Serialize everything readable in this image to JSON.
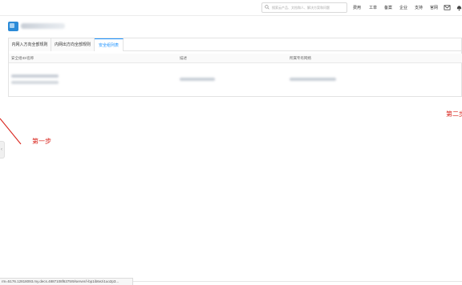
{
  "topbar": {
    "search_placeholder": "搜索云产品、文档和人、解决方案和问题",
    "nav": [
      "费用",
      "工单",
      "备案",
      "企业",
      "支持",
      "官网"
    ],
    "icons": [
      "message-icon",
      "bell-icon"
    ]
  },
  "tabs": [
    {
      "label": "内网入方向全部规则",
      "active": false
    },
    {
      "label": "内网出方向全部规则",
      "active": false
    },
    {
      "label": "安全组列表",
      "active": true
    }
  ],
  "table": {
    "columns": [
      "安全组ID/名称",
      "描述",
      "所属专有网络"
    ],
    "row": {
      "id_name": "",
      "description": "",
      "vpc": ""
    }
  },
  "annotations": {
    "step1": "第一步",
    "step2": "第二步"
  },
  "statusbar": {
    "url": "rm=5176.12818093.my.decs.4887108f6375!9/server/i-bp1ib6ezi1uo2p3..."
  },
  "colors": {
    "accent": "#1890ff",
    "annotation": "#d9251d",
    "logo": "#2b8bd8"
  }
}
